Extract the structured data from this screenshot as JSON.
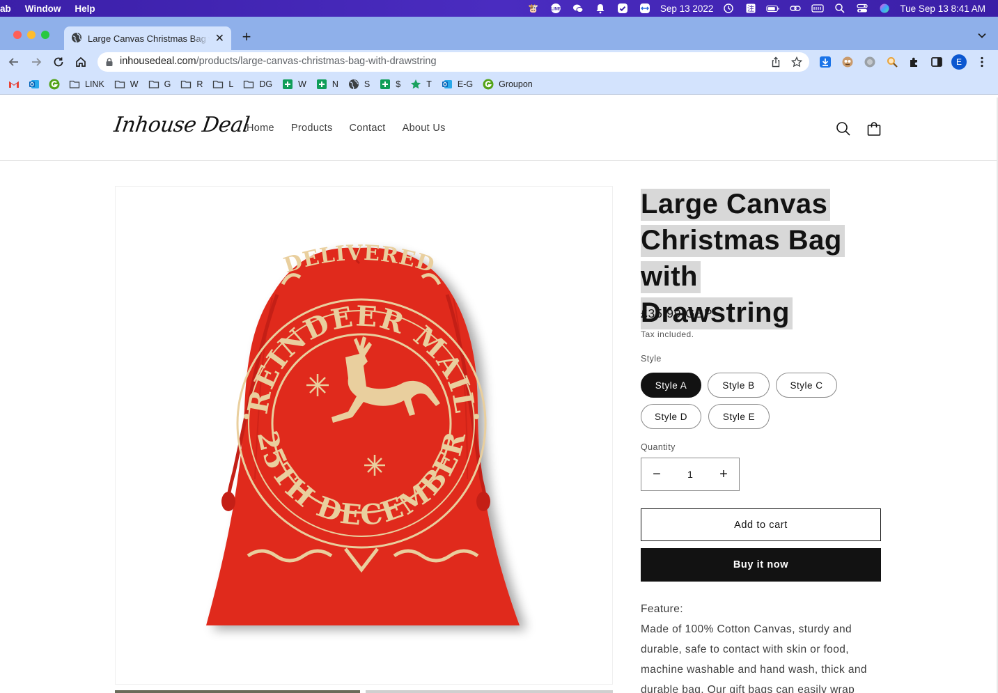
{
  "menubar": {
    "app_fragment": "ab",
    "menus": [
      "Window",
      "Help"
    ],
    "date_short": "Sep 13 2022",
    "clock": "Tue Sep 13  8:41 AM"
  },
  "browser": {
    "tab_title": "Large Canvas Christmas Bag with Drawstring",
    "url_domain": "inhousedeal.com",
    "url_path": "/products/large-canvas-christmas-bag-with-drawstring",
    "profile_initial": "E",
    "bookmarks": [
      {
        "label": "",
        "icon": "gmail-icon"
      },
      {
        "label": "",
        "icon": "outlook-icon"
      },
      {
        "label": "",
        "icon": "groupon-g-icon"
      },
      {
        "label": "LINK",
        "icon": "folder-icon"
      },
      {
        "label": "W",
        "icon": "folder-icon"
      },
      {
        "label": "G",
        "icon": "folder-icon"
      },
      {
        "label": "R",
        "icon": "folder-icon"
      },
      {
        "label": "L",
        "icon": "folder-icon"
      },
      {
        "label": "DG",
        "icon": "folder-icon"
      },
      {
        "label": "W",
        "icon": "sheets-icon"
      },
      {
        "label": "N",
        "icon": "sheets-icon"
      },
      {
        "label": "S",
        "icon": "globe-icon"
      },
      {
        "label": "$",
        "icon": "sheets-icon"
      },
      {
        "label": "T",
        "icon": "star-icon"
      },
      {
        "label": "E-G",
        "icon": "outlook-icon"
      },
      {
        "label": "Groupon",
        "icon": "groupon-g-icon"
      }
    ]
  },
  "site": {
    "logo": "Inhouse Deal",
    "nav": [
      "Home",
      "Products",
      "Contact",
      "About Us"
    ]
  },
  "product": {
    "title_lines": [
      "Large Canvas",
      "Christmas Bag with",
      "Drawstring"
    ],
    "price": "£35.99 GBP",
    "tax_note": "Tax included.",
    "style_label": "Style",
    "styles": [
      "Style A",
      "Style B",
      "Style C",
      "Style D",
      "Style E"
    ],
    "selected_style": "Style A",
    "quantity_label": "Quantity",
    "quantity": "1",
    "add_to_cart": "Add to cart",
    "buy_now": "Buy it now",
    "description_heading": "Feature:",
    "description_lines": [
      "Made of 100% Cotton Canvas, sturdy and",
      "durable, safe to contact with skin or food,",
      "machine washable and hand wash, thick and",
      "durable bag. Our gift bags can easily wrap large"
    ],
    "image_text": {
      "arc_top": "REINDEER MAIL",
      "arc_bottom": "25TH DECEMBER",
      "top_word": "DELIVERED"
    }
  },
  "colors": {
    "bag_red": "#e02a1f",
    "bag_gold": "#e9cf9e",
    "menubar": "#3b1fa8",
    "chrome": "#d3e3fd",
    "button_dark": "#121212"
  }
}
